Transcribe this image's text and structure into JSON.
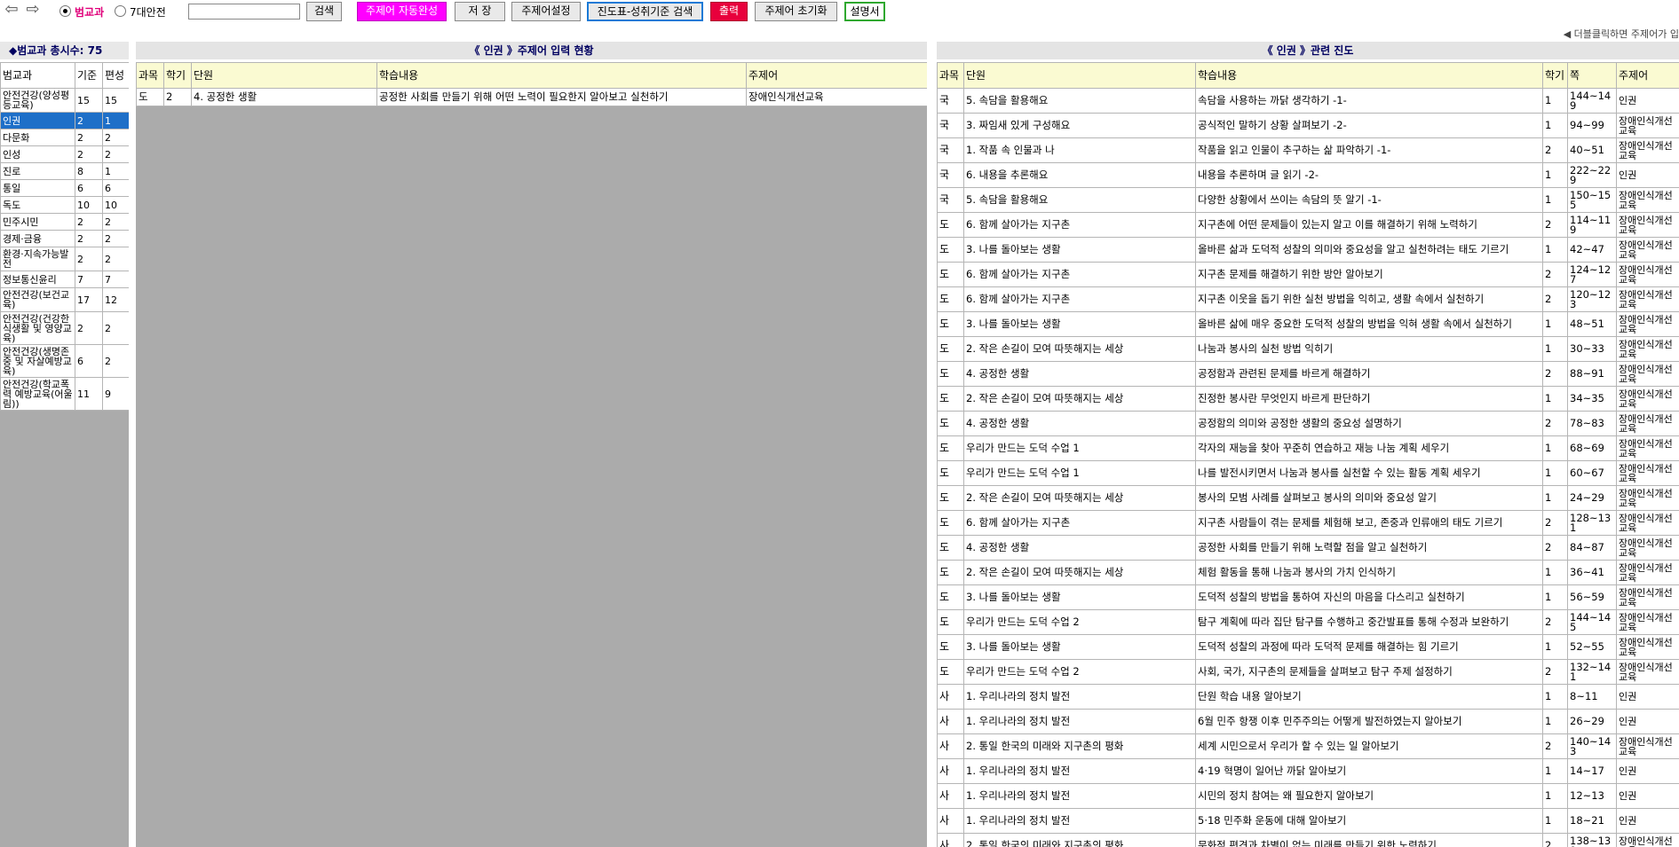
{
  "toolbar": {
    "back_icon": "arrow-left-icon",
    "forward_icon": "arrow-right-icon",
    "radio_a": "범교과",
    "radio_b": "7대안전",
    "search_value": "",
    "search_button": "검색",
    "autocomplete_button": "주제어 자동완성",
    "save_button": "저 장",
    "topic_setting_button": "주제어설정",
    "progress_search_button": "진도표-성취기준 검색",
    "print_button": "출력",
    "reset_button": "주제어 초기화",
    "manual_button": "설명서",
    "hint": "◀ 더블클릭하면 주제어가 입"
  },
  "left": {
    "title": "◆범교과 총시수: 75",
    "headers": [
      "범교과",
      "기준",
      "편성"
    ],
    "rows": [
      {
        "name": "안전건강(양성평등교육)",
        "base": "15",
        "plan": "15"
      },
      {
        "name": "인권",
        "base": "2",
        "plan": "1"
      },
      {
        "name": "다문화",
        "base": "2",
        "plan": "2"
      },
      {
        "name": "인성",
        "base": "2",
        "plan": "2"
      },
      {
        "name": "진로",
        "base": "8",
        "plan": "1"
      },
      {
        "name": "통일",
        "base": "6",
        "plan": "6"
      },
      {
        "name": "독도",
        "base": "10",
        "plan": "10"
      },
      {
        "name": "민주시민",
        "base": "2",
        "plan": "2"
      },
      {
        "name": "경제·금융",
        "base": "2",
        "plan": "2"
      },
      {
        "name": "환경·지속가능발전",
        "base": "2",
        "plan": "2"
      },
      {
        "name": "정보통신윤리",
        "base": "7",
        "plan": "7"
      },
      {
        "name": "안전건강(보건교육)",
        "base": "17",
        "plan": "12"
      },
      {
        "name": "안전건강(건강한 식생활 및 영양교육)",
        "base": "2",
        "plan": "2"
      },
      {
        "name": "안전건강(생명존중 및 자살예방교육)",
        "base": "6",
        "plan": "2"
      },
      {
        "name": "안전건강(학교폭력 예방교육(어울림))",
        "base": "11",
        "plan": "9"
      }
    ]
  },
  "middle": {
    "title": "《 인권 》주제어 입력 현황",
    "headers": [
      "과목",
      "학기",
      "단원",
      "학습내용",
      "주제어"
    ],
    "rows": [
      {
        "subject": "도",
        "term": "2",
        "unit": "4. 공정한 생활",
        "content": "공정한 사회를 만들기 위해 어떤 노력이 필요한지 알아보고 실천하기",
        "topic": "장애인식개선교육"
      }
    ]
  },
  "right": {
    "title": "《 인권 》관련 진도",
    "headers": [
      "과목",
      "단원",
      "학습내용",
      "학기",
      "쪽",
      "주제어"
    ],
    "rows": [
      {
        "subject": "국",
        "unit": "5. 속담을 활용해요",
        "content": "속담을 사용하는 까닭 생각하기 -1-",
        "term": "1",
        "page": "144~149",
        "topic": "인권"
      },
      {
        "subject": "국",
        "unit": "3. 짜임새 있게 구성해요",
        "content": "공식적인 말하기 상황 살펴보기 -2-",
        "term": "1",
        "page": "94~99",
        "topic": "장애인식개선교육"
      },
      {
        "subject": "국",
        "unit": "1. 작품 속 인물과 나",
        "content": "작품을 읽고 인물이 추구하는 삶 파악하기 -1-",
        "term": "2",
        "page": "40~51",
        "topic": "장애인식개선교육"
      },
      {
        "subject": "국",
        "unit": "6. 내용을 추론해요",
        "content": "내용을 추론하며 글 읽기 -2-",
        "term": "1",
        "page": "222~229",
        "topic": "인권"
      },
      {
        "subject": "국",
        "unit": "5. 속담을 활용해요",
        "content": "다양한 상황에서 쓰이는 속담의 뜻 알기 -1-",
        "term": "1",
        "page": "150~155",
        "topic": "장애인식개선교육"
      },
      {
        "subject": "도",
        "unit": "6. 함께 살아가는 지구촌",
        "content": "지구촌에 어떤 문제들이 있는지 알고 이를 해결하기 위해 노력하기",
        "term": "2",
        "page": "114~119",
        "topic": "장애인식개선교육"
      },
      {
        "subject": "도",
        "unit": "3. 나를 돌아보는 생활",
        "content": "올바른 삶과 도덕적 성찰의 의미와 중요성을 알고 실천하려는 태도 기르기",
        "term": "1",
        "page": "42~47",
        "topic": "장애인식개선교육"
      },
      {
        "subject": "도",
        "unit": "6. 함께 살아가는 지구촌",
        "content": "지구촌 문제를 해결하기 위한 방안 알아보기",
        "term": "2",
        "page": "124~127",
        "topic": "장애인식개선교육"
      },
      {
        "subject": "도",
        "unit": "6. 함께 살아가는 지구촌",
        "content": "지구촌 이웃을 돕기 위한 실천 방법을 익히고, 생활 속에서 실천하기",
        "term": "2",
        "page": "120~123",
        "topic": "장애인식개선교육"
      },
      {
        "subject": "도",
        "unit": "3. 나를 돌아보는 생활",
        "content": "올바른 삶에 매우 중요한 도덕적 성찰의 방법을 익혀 생활 속에서 실천하기",
        "term": "1",
        "page": "48~51",
        "topic": "장애인식개선교육"
      },
      {
        "subject": "도",
        "unit": "2. 작은 손길이 모여 따뜻해지는 세상",
        "content": "나눔과 봉사의 실천 방법 익히기",
        "term": "1",
        "page": "30~33",
        "topic": "장애인식개선교육"
      },
      {
        "subject": "도",
        "unit": "4. 공정한 생활",
        "content": "공정함과 관련된 문제를 바르게 해결하기",
        "term": "2",
        "page": "88~91",
        "topic": "장애인식개선교육"
      },
      {
        "subject": "도",
        "unit": "2. 작은 손길이 모여 따뜻해지는 세상",
        "content": "진정한 봉사란 무엇인지 바르게 판단하기",
        "term": "1",
        "page": "34~35",
        "topic": "장애인식개선교육"
      },
      {
        "subject": "도",
        "unit": "4. 공정한 생활",
        "content": "공정함의 의미와 공정한 생활의 중요성 설명하기",
        "term": "2",
        "page": "78~83",
        "topic": "장애인식개선교육"
      },
      {
        "subject": "도",
        "unit": "우리가 만드는 도덕 수업 1",
        "content": "각자의 재능을 찾아 꾸준히 연습하고 재능 나눔 계획 세우기",
        "term": "1",
        "page": "68~69",
        "topic": "장애인식개선교육"
      },
      {
        "subject": "도",
        "unit": "우리가 만드는 도덕 수업 1",
        "content": "나를 발전시키면서 나눔과 봉사를 실천할 수 있는 활동 계획 세우기",
        "term": "1",
        "page": "60~67",
        "topic": "장애인식개선교육"
      },
      {
        "subject": "도",
        "unit": "2. 작은 손길이 모여 따뜻해지는 세상",
        "content": "봉사의 모범 사례를 살펴보고 봉사의 의미와 중요성 알기",
        "term": "1",
        "page": "24~29",
        "topic": "장애인식개선교육"
      },
      {
        "subject": "도",
        "unit": "6. 함께 살아가는 지구촌",
        "content": "지구촌 사람들이 겪는 문제를 체험해 보고, 존중과 인류애의 태도 기르기",
        "term": "2",
        "page": "128~131",
        "topic": "장애인식개선교육"
      },
      {
        "subject": "도",
        "unit": "4. 공정한 생활",
        "content": "공정한 사회를 만들기 위해 노력할 점을 알고 실천하기",
        "term": "2",
        "page": "84~87",
        "topic": "장애인식개선교육"
      },
      {
        "subject": "도",
        "unit": "2. 작은 손길이 모여 따뜻해지는 세상",
        "content": "체험 활동을 통해 나눔과 봉사의 가치 인식하기",
        "term": "1",
        "page": "36~41",
        "topic": "장애인식개선교육"
      },
      {
        "subject": "도",
        "unit": "3. 나를 돌아보는 생활",
        "content": "도덕적 성찰의 방법을 통하여 자신의 마음을 다스리고 실천하기",
        "term": "1",
        "page": "56~59",
        "topic": "장애인식개선교육"
      },
      {
        "subject": "도",
        "unit": "우리가 만드는 도덕 수업 2",
        "content": "탐구 계획에 따라 집단 탐구를 수행하고 중간발표를 통해 수정과 보완하기",
        "term": "2",
        "page": "144~145",
        "topic": "장애인식개선교육"
      },
      {
        "subject": "도",
        "unit": "3. 나를 돌아보는 생활",
        "content": "도덕적 성찰의 과정에 따라 도덕적 문제를 해결하는 힘 기르기",
        "term": "1",
        "page": "52~55",
        "topic": "장애인식개선교육"
      },
      {
        "subject": "도",
        "unit": "우리가 만드는 도덕 수업 2",
        "content": "사회, 국가, 지구촌의 문제들을 살펴보고 탐구 주제 설정하기",
        "term": "2",
        "page": "132~141",
        "topic": "장애인식개선교육"
      },
      {
        "subject": "사",
        "unit": "1. 우리나라의 정치 발전",
        "content": "단원 학습 내용 알아보기",
        "term": "1",
        "page": "8~11",
        "topic": "인권"
      },
      {
        "subject": "사",
        "unit": "1. 우리나라의 정치 발전",
        "content": "6월 민주 항쟁 이후 민주주의는 어떻게 발전하였는지 알아보기",
        "term": "1",
        "page": "26~29",
        "topic": "인권"
      },
      {
        "subject": "사",
        "unit": "2. 통일 한국의 미래와 지구촌의 평화",
        "content": "세계 시민으로서 우리가 할 수 있는 일 알아보기",
        "term": "2",
        "page": "140~143",
        "topic": "장애인식개선교육"
      },
      {
        "subject": "사",
        "unit": "1. 우리나라의 정치 발전",
        "content": "4·19 혁명이 일어난 까닭 알아보기",
        "term": "1",
        "page": "14~17",
        "topic": "인권"
      },
      {
        "subject": "사",
        "unit": "1. 우리나라의 정치 발전",
        "content": "시민의 정치 참여는 왜 필요한지 알아보기",
        "term": "1",
        "page": "12~13",
        "topic": "인권"
      },
      {
        "subject": "사",
        "unit": "1. 우리나라의 정치 발전",
        "content": "5·18 민주화 운동에 대해 알아보기",
        "term": "1",
        "page": "18~21",
        "topic": "인권"
      },
      {
        "subject": "사",
        "unit": "2. 통일 한국의 미래와 지구촌의 평화",
        "content": "문화적 편견과 차별이 없는 미래를 만들기 위한 노력하기",
        "term": "2",
        "page": "138~139",
        "topic": "장애인식개선교육"
      }
    ]
  }
}
